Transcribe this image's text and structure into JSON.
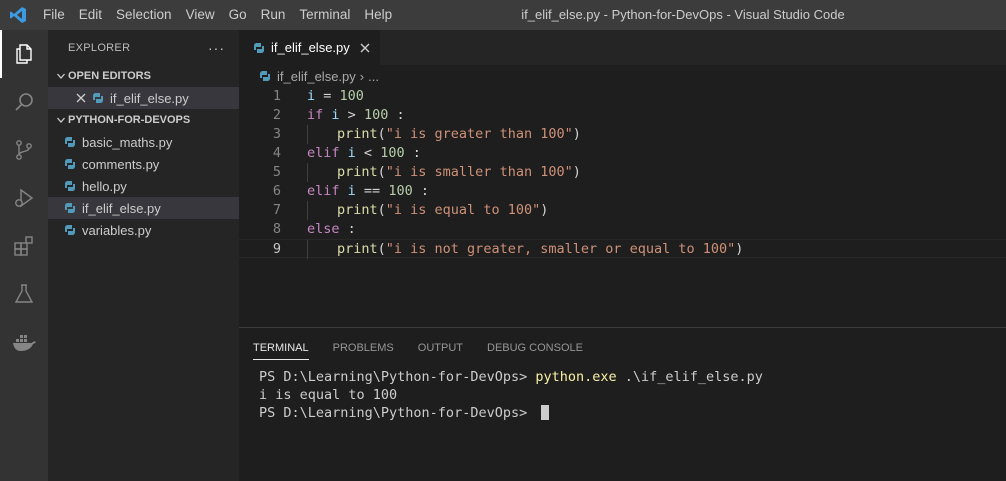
{
  "titlebar": {
    "menu": [
      "File",
      "Edit",
      "Selection",
      "View",
      "Go",
      "Run",
      "Terminal",
      "Help"
    ],
    "window_title": "if_elif_else.py - Python-for-DevOps - Visual Studio Code"
  },
  "activitybar": {
    "icons": [
      "explorer-icon",
      "search-icon",
      "source-control-icon",
      "run-debug-icon",
      "extensions-icon",
      "testing-icon",
      "docker-icon"
    ]
  },
  "sidebar": {
    "title": "EXPLORER",
    "more": "···",
    "open_editors": {
      "label": "OPEN EDITORS",
      "items": [
        "if_elif_else.py"
      ]
    },
    "folder": {
      "label": "PYTHON-FOR-DEVOPS",
      "files": [
        "basic_maths.py",
        "comments.py",
        "hello.py",
        "if_elif_else.py",
        "variables.py"
      ]
    }
  },
  "editor": {
    "tab_label": "if_elif_else.py",
    "breadcrumb": {
      "file": "if_elif_else.py",
      "rest": "..."
    },
    "line_numbers": [
      "1",
      "2",
      "3",
      "4",
      "5",
      "6",
      "7",
      "8",
      "9"
    ],
    "code": {
      "l1": {
        "var": "i",
        "op": " = ",
        "num": "100"
      },
      "l2": {
        "kw": "if",
        "var": "i",
        "op": " > ",
        "num": "100",
        "end": " :"
      },
      "l3": {
        "fn": "print",
        "open": "(",
        "str": "\"i is greater than 100\"",
        "close": ")"
      },
      "l4": {
        "kw": "elif",
        "var": "i",
        "op": " < ",
        "num": "100",
        "end": " :"
      },
      "l5": {
        "fn": "print",
        "open": "(",
        "str": "\"i is smaller than 100\"",
        "close": ")"
      },
      "l6": {
        "kw": "elif",
        "var": "i",
        "op": " == ",
        "num": "100",
        "end": " :"
      },
      "l7": {
        "fn": "print",
        "open": "(",
        "str": "\"i is equal to 100\"",
        "close": ")"
      },
      "l8": {
        "kw": "else",
        "end": " :"
      },
      "l9": {
        "fn": "print",
        "open": "(",
        "str": "\"i is not greater, smaller or equal to 100\"",
        "close": ")"
      }
    }
  },
  "panel": {
    "tabs": [
      "TERMINAL",
      "PROBLEMS",
      "OUTPUT",
      "DEBUG CONSOLE"
    ],
    "terminal": {
      "prompt": "PS D:\\Learning\\Python-for-DevOps> ",
      "command": "python.exe",
      "args": " .\\if_elif_else.py",
      "output": "i is equal to 100"
    }
  },
  "colors": {
    "titlebar": "#3c3c3c",
    "activitybar": "#333333",
    "sidebar": "#252526",
    "editor": "#1e1e1e",
    "vscode_blue": "#3b9ae1",
    "python_blue": "#519aba"
  }
}
